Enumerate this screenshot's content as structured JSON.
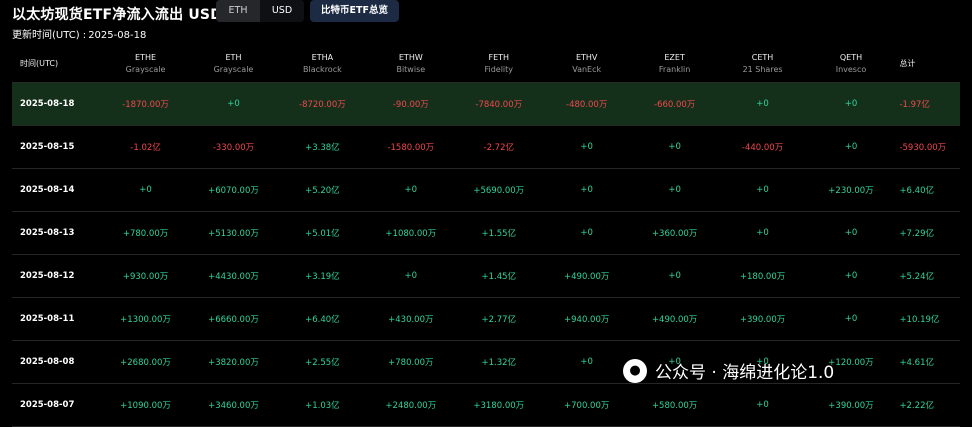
{
  "header": {
    "title": "以太坊现货ETF净流入流出 USD",
    "toggle": [
      "ETH",
      "USD"
    ],
    "toggle_active": "USD",
    "btc_button": "比特币ETF总览",
    "updated_label": "更新时间(UTC) :",
    "updated_date": "2025-08-18"
  },
  "columns": [
    {
      "name": "时间(UTC)",
      "sub": ""
    },
    {
      "name": "ETHE",
      "sub": "Grayscale"
    },
    {
      "name": "ETH",
      "sub": "Grayscale"
    },
    {
      "name": "ETHA",
      "sub": "Blackrock"
    },
    {
      "name": "ETHW",
      "sub": "Bitwise"
    },
    {
      "name": "FETH",
      "sub": "Fidelity"
    },
    {
      "name": "ETHV",
      "sub": "VanEck"
    },
    {
      "name": "EZET",
      "sub": "Franklin"
    },
    {
      "name": "CETH",
      "sub": "21 Shares"
    },
    {
      "name": "QETH",
      "sub": "Invesco"
    },
    {
      "name": "总计",
      "sub": ""
    }
  ],
  "rows": [
    {
      "date": "2025-08-18",
      "values": [
        "-1870.00万",
        "+0",
        "-8720.00万",
        "-90.00万",
        "-7840.00万",
        "-480.00万",
        "-660.00万",
        "+0",
        "+0",
        "-1.97亿"
      ]
    },
    {
      "date": "2025-08-15",
      "values": [
        "-1.02亿",
        "-330.00万",
        "+3.38亿",
        "-1580.00万",
        "-2.72亿",
        "+0",
        "+0",
        "-440.00万",
        "+0",
        "-5930.00万"
      ]
    },
    {
      "date": "2025-08-14",
      "values": [
        "+0",
        "+6070.00万",
        "+5.20亿",
        "+0",
        "+5690.00万",
        "+0",
        "+0",
        "+0",
        "+230.00万",
        "+6.40亿"
      ]
    },
    {
      "date": "2025-08-13",
      "values": [
        "+780.00万",
        "+5130.00万",
        "+5.01亿",
        "+1080.00万",
        "+1.55亿",
        "+0",
        "+360.00万",
        "+0",
        "+0",
        "+7.29亿"
      ]
    },
    {
      "date": "2025-08-12",
      "values": [
        "+930.00万",
        "+4430.00万",
        "+3.19亿",
        "+0",
        "+1.45亿",
        "+490.00万",
        "+0",
        "+180.00万",
        "+0",
        "+5.24亿"
      ]
    },
    {
      "date": "2025-08-11",
      "values": [
        "+1300.00万",
        "+6660.00万",
        "+6.40亿",
        "+430.00万",
        "+2.77亿",
        "+940.00万",
        "+490.00万",
        "+390.00万",
        "+0",
        "+10.19亿"
      ]
    },
    {
      "date": "2025-08-08",
      "values": [
        "+2680.00万",
        "+3820.00万",
        "+2.55亿",
        "+780.00万",
        "+1.32亿",
        "+0",
        "+0",
        "+0",
        "+120.00万",
        "+4.61亿"
      ]
    },
    {
      "date": "2025-08-07",
      "values": [
        "+1090.00万",
        "+3460.00万",
        "+1.03亿",
        "+2480.00万",
        "+3180.00万",
        "+700.00万",
        "+580.00万",
        "+0",
        "+390.00万",
        "+2.22亿"
      ]
    }
  ],
  "colors": {
    "positive": "#2fd49e",
    "negative": "#f0474f",
    "highlight_row": "#15301a"
  },
  "watermark": {
    "icon": "wechat-icon",
    "text": "公众号 · 海绵进化论1.0"
  }
}
